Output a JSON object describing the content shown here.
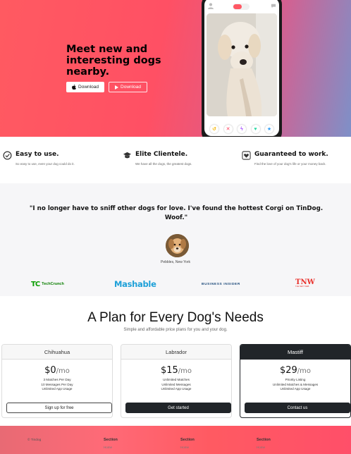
{
  "hero": {
    "title": "Meet new and interesting dogs nearby.",
    "download_apple": "Download",
    "download_play": "Download",
    "gradient_start": "#ff5a61",
    "gradient_end": "#7e90c8"
  },
  "phone": {
    "icons": {
      "profile": "user-icon",
      "toggle": "flame-toggle",
      "messages": "chat-icon"
    },
    "actions": [
      "undo-icon",
      "nope-icon",
      "boost-icon",
      "like-icon",
      "superlike-icon"
    ]
  },
  "features": [
    {
      "title": "Easy to use.",
      "desc": "So easy to use, even your dog could do it.",
      "icon": "check-circle-icon"
    },
    {
      "title": "Elite Clientele.",
      "desc": "We have all the dogs, the greatest dogs.",
      "icon": "graduation-cap-icon"
    },
    {
      "title": "Guaranteed to work.",
      "desc": "Find the love of your dog's life or your money back.",
      "icon": "heart-icon"
    }
  ],
  "testimonial": {
    "quote": "\"I no longer have to sniff other dogs for love. I've found the hottest Corgi on TinDog. Woof.\"",
    "author": "Pebbles, New York"
  },
  "press": {
    "techcrunch_mark": "TC",
    "techcrunch": "TechCrunch",
    "mashable": "Mashable",
    "business_insider": "BUSINESS INSIDER",
    "tnw": "TNW",
    "tnw_sub": "THE NEXT WEB"
  },
  "pricing": {
    "title": "A Plan for Every Dog's Needs",
    "subtitle": "Simple and affordable price plans for you and your dog.",
    "plans": [
      {
        "name": "Chihuahua",
        "price": "$0",
        "per": "/mo",
        "features": [
          "3 Matches Per Day",
          "10 Messages Per Day",
          "Unlimited App Usage"
        ],
        "cta": "Sign up for free"
      },
      {
        "name": "Labrador",
        "price": "$15",
        "per": "/mo",
        "features": [
          "Unlimited Matches",
          "Unlimited Messages",
          "Unlimited App Usage"
        ],
        "cta": "Get started"
      },
      {
        "name": "Mastiff",
        "price": "$29",
        "per": "/mo",
        "features": [
          "Pirority Listing",
          "Unlimited Matches & Messages",
          "Unlimited App Usage"
        ],
        "cta": "Contact us"
      }
    ]
  },
  "footer": {
    "copyright": "© Tindog",
    "sections": [
      {
        "title": "Section",
        "sub": "Home"
      },
      {
        "title": "Section",
        "sub": "Home"
      },
      {
        "title": "Section",
        "sub": "Home"
      }
    ]
  }
}
